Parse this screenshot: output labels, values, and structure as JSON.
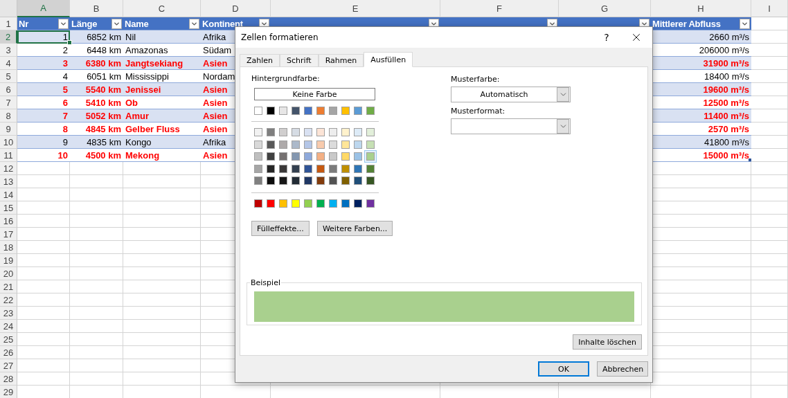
{
  "sheet": {
    "column_headers": [
      {
        "label": "A",
        "selected": true
      },
      {
        "label": "B",
        "selected": false
      },
      {
        "label": "C",
        "selected": false
      },
      {
        "label": "D",
        "selected": false
      },
      {
        "label": "E",
        "selected": false
      },
      {
        "label": "F",
        "selected": false
      },
      {
        "label": "G",
        "selected": false
      },
      {
        "label": "H",
        "selected": false
      },
      {
        "label": "I",
        "selected": false
      }
    ],
    "row_headers": [
      {
        "label": "1",
        "selected": false
      },
      {
        "label": "2",
        "selected": true
      },
      {
        "label": "3",
        "selected": false
      },
      {
        "label": "4",
        "selected": false
      },
      {
        "label": "5",
        "selected": false
      },
      {
        "label": "6",
        "selected": false
      },
      {
        "label": "7",
        "selected": false
      },
      {
        "label": "8",
        "selected": false
      },
      {
        "label": "9",
        "selected": false
      },
      {
        "label": "10",
        "selected": false
      },
      {
        "label": "11",
        "selected": false
      },
      {
        "label": "12",
        "selected": false
      },
      {
        "label": "13",
        "selected": false
      },
      {
        "label": "14",
        "selected": false
      },
      {
        "label": "15",
        "selected": false
      },
      {
        "label": "16",
        "selected": false
      },
      {
        "label": "17",
        "selected": false
      },
      {
        "label": "18",
        "selected": false
      },
      {
        "label": "19",
        "selected": false
      },
      {
        "label": "20",
        "selected": false
      },
      {
        "label": "21",
        "selected": false
      },
      {
        "label": "22",
        "selected": false
      },
      {
        "label": "23",
        "selected": false
      },
      {
        "label": "24",
        "selected": false
      },
      {
        "label": "25",
        "selected": false
      },
      {
        "label": "26",
        "selected": false
      },
      {
        "label": "27",
        "selected": false
      },
      {
        "label": "28",
        "selected": false
      },
      {
        "label": "29",
        "selected": false
      }
    ],
    "table_columns": [
      "Nr",
      "Länge",
      "Name",
      "Kontinent",
      "Mittlerer Abfluss"
    ],
    "rows": [
      {
        "nr": "1",
        "length": "6852 km",
        "name": "Nil",
        "continent": "Afrika",
        "discharge": "2660 m³/s",
        "emphasized": false
      },
      {
        "nr": "2",
        "length": "6448 km",
        "name": "Amazonas",
        "continent": "Südam",
        "discharge": "206000 m³/s",
        "emphasized": false
      },
      {
        "nr": "3",
        "length": "6380 km",
        "name": "Jangtsekiang",
        "continent": "Asien",
        "discharge": "31900 m³/s",
        "emphasized": true
      },
      {
        "nr": "4",
        "length": "6051 km",
        "name": "Mississippi",
        "continent": "Nordam",
        "discharge": "18400 m³/s",
        "emphasized": false
      },
      {
        "nr": "5",
        "length": "5540 km",
        "name": "Jenissei",
        "continent": "Asien",
        "discharge": "19600 m³/s",
        "emphasized": true
      },
      {
        "nr": "6",
        "length": "5410 km",
        "name": "Ob",
        "continent": "Asien",
        "discharge": "12500 m³/s",
        "emphasized": true
      },
      {
        "nr": "7",
        "length": "5052 km",
        "name": "Amur",
        "continent": "Asien",
        "discharge": "11400 m³/s",
        "emphasized": true
      },
      {
        "nr": "8",
        "length": "4845 km",
        "name": "Gelber Fluss",
        "continent": "Asien",
        "discharge": "2570 m³/s",
        "emphasized": true
      },
      {
        "nr": "9",
        "length": "4835 km",
        "name": "Kongo",
        "continent": "Afrika",
        "discharge": "41800 m³/s",
        "emphasized": false
      },
      {
        "nr": "10",
        "length": "4500 km",
        "name": "Mekong",
        "continent": "Asien",
        "discharge": "15000 m³/s",
        "emphasized": true
      }
    ]
  },
  "dialog": {
    "title": "Zellen formatieren",
    "help": "?",
    "tabs": [
      {
        "label": "Zahlen",
        "selected": false
      },
      {
        "label": "Schrift",
        "selected": false
      },
      {
        "label": "Rahmen",
        "selected": false
      },
      {
        "label": "Ausfüllen",
        "selected": true
      }
    ],
    "background_label": "Hintergrundfarbe:",
    "no_color_button": "Keine Farbe",
    "palette": [
      [
        {
          "color": "#ffffff",
          "selected": false
        },
        {
          "color": "#000000",
          "selected": false
        },
        {
          "color": "#e7e6e6",
          "selected": false
        },
        {
          "color": "#44546a",
          "selected": false
        },
        {
          "color": "#4472c4",
          "selected": false
        },
        {
          "color": "#ed7d31",
          "selected": false
        },
        {
          "color": "#a5a5a5",
          "selected": false
        },
        {
          "color": "#ffc000",
          "selected": false
        },
        {
          "color": "#5b9bd5",
          "selected": false
        },
        {
          "color": "#70ad47",
          "selected": false
        }
      ],
      [
        {
          "color": "#f2f2f2",
          "selected": false
        },
        {
          "color": "#7f7f7f",
          "selected": false
        },
        {
          "color": "#d0cece",
          "selected": false
        },
        {
          "color": "#d6dce4",
          "selected": false
        },
        {
          "color": "#d9e1f2",
          "selected": false
        },
        {
          "color": "#fce4d6",
          "selected": false
        },
        {
          "color": "#ededed",
          "selected": false
        },
        {
          "color": "#fff2cc",
          "selected": false
        },
        {
          "color": "#ddebf7",
          "selected": false
        },
        {
          "color": "#e2efda",
          "selected": false
        }
      ],
      [
        {
          "color": "#d9d9d9",
          "selected": false
        },
        {
          "color": "#595959",
          "selected": false
        },
        {
          "color": "#aeaaaa",
          "selected": false
        },
        {
          "color": "#acb9ca",
          "selected": false
        },
        {
          "color": "#b4c6e7",
          "selected": false
        },
        {
          "color": "#f8cbad",
          "selected": false
        },
        {
          "color": "#dbdbdb",
          "selected": false
        },
        {
          "color": "#ffe699",
          "selected": false
        },
        {
          "color": "#bdd7ee",
          "selected": false
        },
        {
          "color": "#c6e0b4",
          "selected": false
        }
      ],
      [
        {
          "color": "#bfbfbf",
          "selected": false
        },
        {
          "color": "#404040",
          "selected": false
        },
        {
          "color": "#757171",
          "selected": false
        },
        {
          "color": "#8497b0",
          "selected": false
        },
        {
          "color": "#8ea9db",
          "selected": false
        },
        {
          "color": "#f4b084",
          "selected": false
        },
        {
          "color": "#c9c9c9",
          "selected": false
        },
        {
          "color": "#ffd966",
          "selected": false
        },
        {
          "color": "#9bc2e6",
          "selected": false
        },
        {
          "color": "#a9d08e",
          "selected": true
        }
      ],
      [
        {
          "color": "#a6a6a6",
          "selected": false
        },
        {
          "color": "#262626",
          "selected": false
        },
        {
          "color": "#3a3838",
          "selected": false
        },
        {
          "color": "#333f4f",
          "selected": false
        },
        {
          "color": "#305496",
          "selected": false
        },
        {
          "color": "#c65911",
          "selected": false
        },
        {
          "color": "#7b7b7b",
          "selected": false
        },
        {
          "color": "#bf8f00",
          "selected": false
        },
        {
          "color": "#2f75b5",
          "selected": false
        },
        {
          "color": "#548235",
          "selected": false
        }
      ],
      [
        {
          "color": "#808080",
          "selected": false
        },
        {
          "color": "#0d0d0d",
          "selected": false
        },
        {
          "color": "#161616",
          "selected": false
        },
        {
          "color": "#222b35",
          "selected": false
        },
        {
          "color": "#203764",
          "selected": false
        },
        {
          "color": "#833c0c",
          "selected": false
        },
        {
          "color": "#525252",
          "selected": false
        },
        {
          "color": "#806000",
          "selected": false
        },
        {
          "color": "#1f4e78",
          "selected": false
        },
        {
          "color": "#375623",
          "selected": false
        }
      ],
      [
        {
          "color": "#c00000",
          "selected": false
        },
        {
          "color": "#ff0000",
          "selected": false
        },
        {
          "color": "#ffc000",
          "selected": false
        },
        {
          "color": "#ffff00",
          "selected": false
        },
        {
          "color": "#92d050",
          "selected": false
        },
        {
          "color": "#00b050",
          "selected": false
        },
        {
          "color": "#00b0f0",
          "selected": false
        },
        {
          "color": "#0070c0",
          "selected": false
        },
        {
          "color": "#002060",
          "selected": false
        },
        {
          "color": "#7030a0",
          "selected": false
        }
      ]
    ],
    "fill_effects_button": "Fülleffekte...",
    "more_colors_button": "Weitere Farben...",
    "pattern_color": {
      "label": "Musterfarbe:",
      "value": "Automatisch"
    },
    "pattern_style": {
      "label": "Musterformat:"
    },
    "sample_label": "Beispiel",
    "clear_button": "Inhalte löschen",
    "ok_button": "OK",
    "cancel_button": "Abbrechen"
  }
}
